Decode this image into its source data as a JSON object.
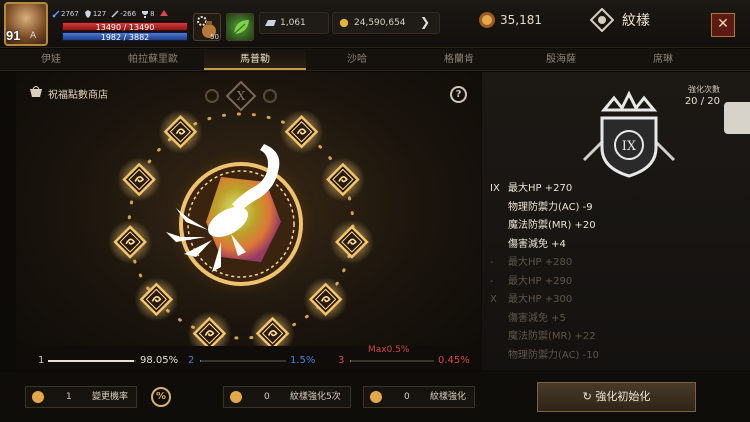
{
  "player": {
    "level": "91",
    "level_suffix": "A",
    "stats": [
      "2767",
      "127",
      "-266",
      "8"
    ],
    "hp": "13490 / 13490",
    "mp": "1982 / 3882"
  },
  "slots": {
    "potion_count": "50"
  },
  "currency": {
    "silver": "1,061",
    "gold": "24,590,654",
    "emblems": "35,181"
  },
  "header": {
    "title": "紋樣",
    "close": "✕"
  },
  "tabs": [
    "伊娃",
    "帕拉蘇里歐",
    "馬普勒",
    "沙哈",
    "格蘭肯",
    "殷海薩",
    "席琳"
  ],
  "active_tab": 2,
  "main": {
    "shop_label": "祝福點數商店",
    "help": "?",
    "center_sign": "X"
  },
  "progress": [
    {
      "num": "1",
      "value": "98.05%",
      "fill": 0.98,
      "color": "#e6e0d2"
    },
    {
      "num": "2",
      "value": "1.5%",
      "fill": 0.015,
      "color": "#4a82d8"
    },
    {
      "num": "3",
      "value": "0.45%",
      "fill": 0.0045,
      "color": "#d84a4a"
    }
  ],
  "progress_max": "Max0.5%",
  "right": {
    "enhance_label": "強化次數",
    "enhance_value": "20 / 20",
    "crest_numeral": "IX",
    "stats_active": [
      {
        "rank": "IX",
        "text": "最大HP +270"
      },
      {
        "rank": "",
        "text": "物理防禦力(AC) -9"
      },
      {
        "rank": "",
        "text": "魔法防禦(MR) +20"
      },
      {
        "rank": "",
        "text": "傷害減免 +4"
      }
    ],
    "stats_inactive": [
      {
        "rank": "-",
        "text": "最大HP +280"
      },
      {
        "rank": "-",
        "text": "最大HP +290"
      },
      {
        "rank": "X",
        "text": "最大HP +300"
      },
      {
        "rank": "",
        "text": "傷害減免 +5"
      },
      {
        "rank": "",
        "text": "魔法防禦(MR) +22"
      },
      {
        "rank": "",
        "text": "物理防禦力(AC) -10"
      }
    ]
  },
  "bottom": {
    "change_prob": {
      "count": "1",
      "label": "變更機率"
    },
    "enhance5": {
      "count": "0",
      "label": "紋樣強化5次"
    },
    "enhance": {
      "count": "0",
      "label": "紋樣強化"
    },
    "pct": "%",
    "reset_button": "強化初始化"
  },
  "colors": {
    "accent": "#c79a4a",
    "gold": "#e2a94a",
    "danger": "#d84a4a",
    "link": "#4a82d8"
  }
}
